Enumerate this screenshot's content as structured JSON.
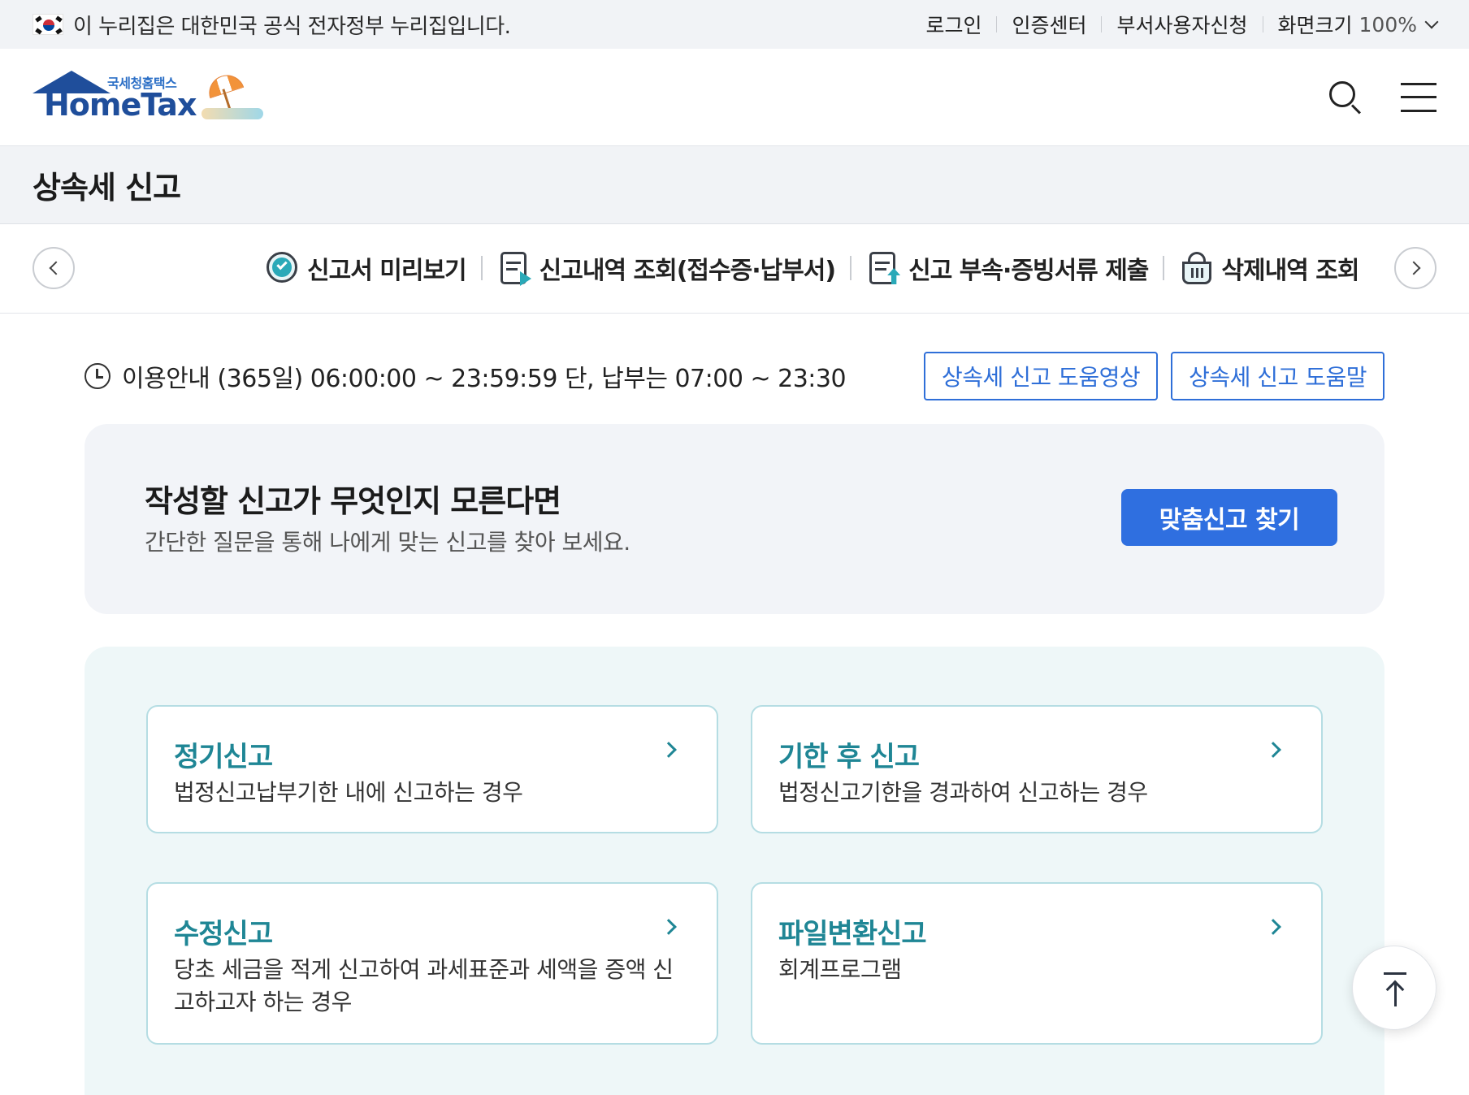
{
  "gov_bar": {
    "notice": "이 누리집은 대한민국 공식 전자정부 누리집입니다.",
    "links": [
      "로그인",
      "인증센터",
      "부서사용자신청"
    ],
    "zoom_label": "화면크기",
    "zoom_value": "100%"
  },
  "header": {
    "logo_sub": "국세청홈택스",
    "logo_main": "HomeTax"
  },
  "page": {
    "title": "상속세 신고"
  },
  "quick_nav": {
    "items": [
      {
        "label": "신고서 미리보기",
        "icon": "preview-check-icon"
      },
      {
        "label": "신고내역 조회(접수증·납부서)",
        "icon": "document-play-icon"
      },
      {
        "label": "신고 부속·증빙서류 제출",
        "icon": "document-upload-icon"
      },
      {
        "label": "삭제내역 조회",
        "icon": "basket-icon"
      }
    ]
  },
  "info": {
    "text": "이용안내 (365일) 06:00:00 ~ 23:59:59 단, 납부는 07:00 ~ 23:30",
    "video_button": "상속세 신고 도움영상",
    "help_button": "상속세 신고 도움말"
  },
  "guide": {
    "title": "작성할 신고가 무엇인지 모른다면",
    "subtitle": "간단한 질문을 통해 나에게 맞는 신고를 찾아 보세요.",
    "button": "맞춤신고 찾기"
  },
  "cards": [
    {
      "title": "정기신고",
      "desc": "법정신고납부기한 내에 신고하는 경우"
    },
    {
      "title": "기한 후 신고",
      "desc": "법정신고기한을 경과하여 신고하는 경우"
    },
    {
      "title": "수정신고",
      "desc": "당초 세금을 적게 신고하여 과세표준과 세액을 증액 신고하고자 하는 경우"
    },
    {
      "title": "파일변환신고",
      "desc": "회계프로그램"
    }
  ],
  "colors": {
    "accent_blue": "#2f6fe0",
    "card_teal": "#1f8695",
    "card_border": "#b5dde3"
  }
}
